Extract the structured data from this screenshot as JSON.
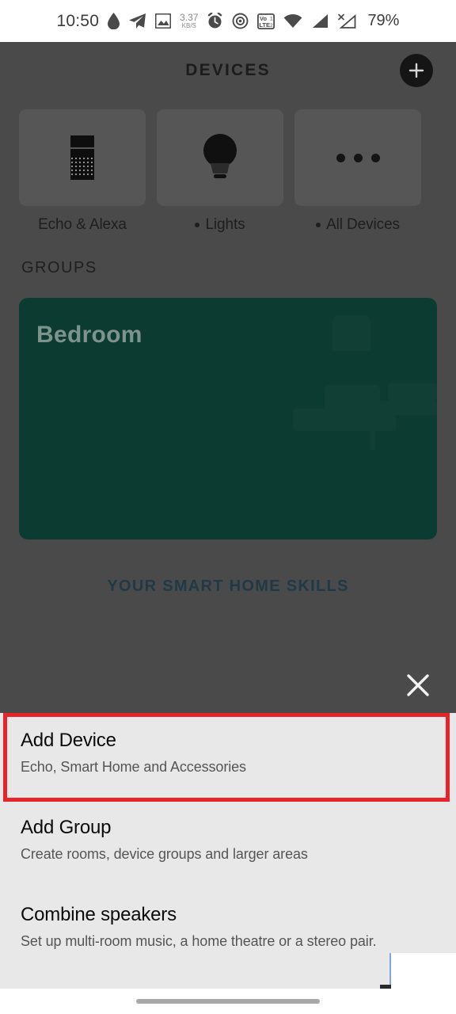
{
  "status_bar": {
    "time": "10:50",
    "battery": "79%",
    "net_speed_value": "3.37",
    "net_speed_unit": "KB/S",
    "icons": [
      "water-drop-icon",
      "telegram-send-icon",
      "image-gallery-icon",
      "alarm-clock-icon",
      "hotspot-icon",
      "volte-sim2-icon",
      "wifi-icon",
      "signal-sim1-icon",
      "signal-sim2-off-icon"
    ]
  },
  "app": {
    "title": "DEVICES",
    "add_button_label": "+",
    "tiles": [
      {
        "label": "Echo & Alexa",
        "icon": "echo-speaker-icon",
        "has_status_dot": false
      },
      {
        "label": "Lights",
        "icon": "light-bulb-icon",
        "has_status_dot": true
      },
      {
        "label": "All Devices",
        "icon": "ellipsis-icon",
        "has_status_dot": true
      }
    ],
    "groups_heading": "GROUPS",
    "group_card": {
      "name": "Bedroom",
      "background_color": "#0c3b31"
    },
    "skills_link": "YOUR SMART HOME SKILLS",
    "close_button_label": "close-x"
  },
  "sheet": {
    "items": [
      {
        "title": "Add Device",
        "subtitle": "Echo, Smart Home and Accessories",
        "highlighted": true
      },
      {
        "title": "Add Group",
        "subtitle": "Create rooms, device groups and larger areas",
        "highlighted": false
      },
      {
        "title": "Combine speakers",
        "subtitle": "Set up multi-room music, a home theatre or a stereo pair.",
        "highlighted": false
      }
    ]
  },
  "annotation": {
    "highlight_color": "#e8232a"
  },
  "nav": {
    "home_indicator": "home-gesture-bar"
  }
}
